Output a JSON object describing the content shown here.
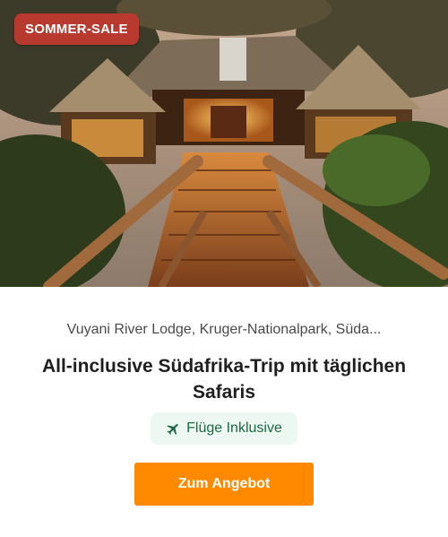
{
  "badge": {
    "label": "SOMMER-SALE",
    "color": "#b83a2e"
  },
  "hero": {
    "image": "safari-lodge-photo",
    "alt_icon": "lodge-image"
  },
  "location": "Vuyani River Lodge, Kruger-Nationalpark, Süda...",
  "title": "All-inclusive Südafrika-Trip mit täglichen Safaris",
  "feature_chip": {
    "icon": "airplane-icon",
    "label": "Flüge Inklusive",
    "color": "#1b6a43",
    "background": "#eef8f2"
  },
  "cta": {
    "label": "Zum Angebot",
    "color": "#ff8a00"
  }
}
